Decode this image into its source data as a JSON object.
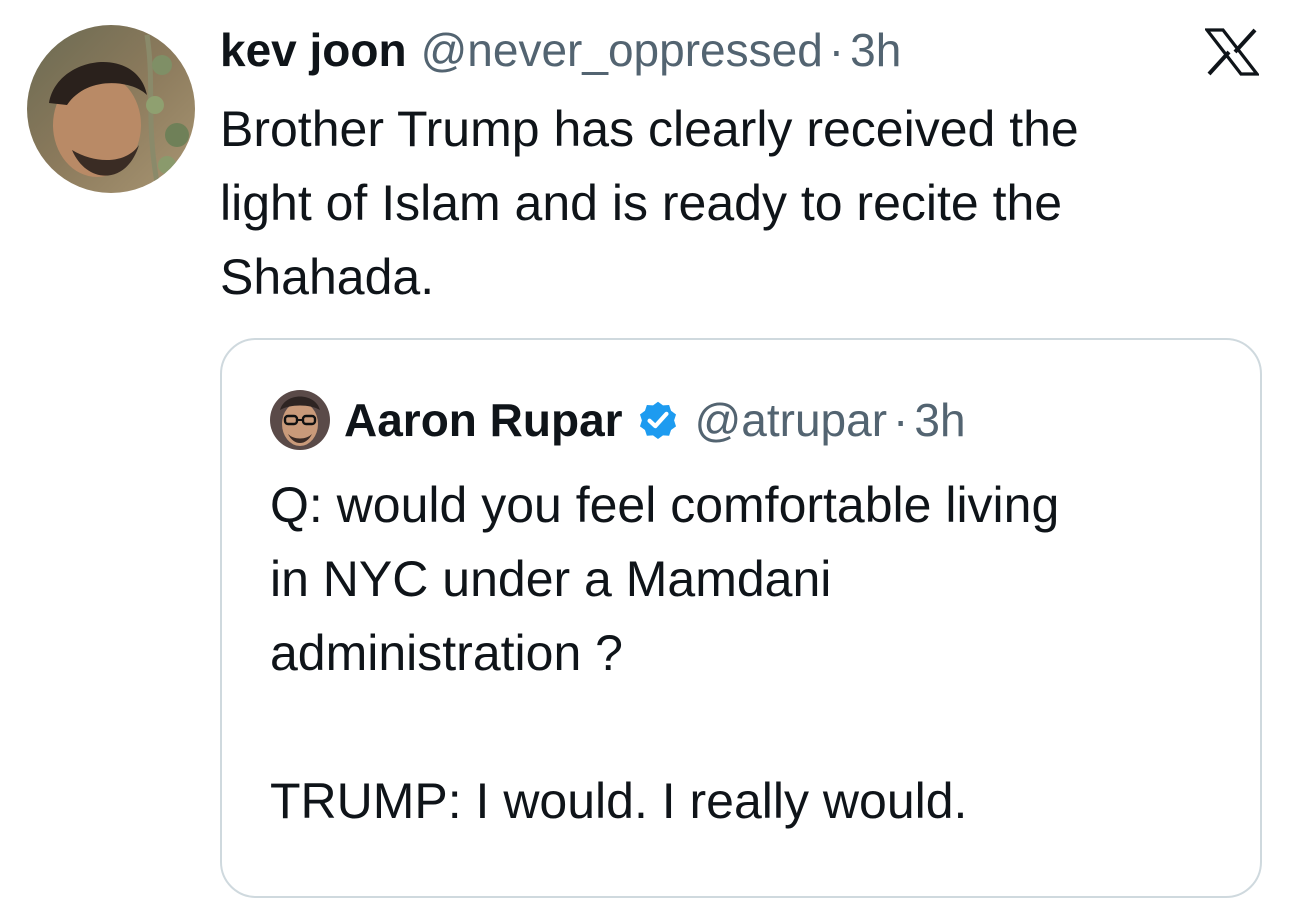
{
  "post": {
    "author_name": "kev joon",
    "handle": "@never_oppressed",
    "separator": "·",
    "time": "3h",
    "text": "Brother Trump has clearly received the\nlight of Islam and is ready to recite the\nShahada.",
    "platform_icon": "x-logo-icon",
    "avatar_icon": "profile-photo"
  },
  "quoted_post": {
    "author_name": "Aaron Rupar",
    "verified": true,
    "verified_icon": "verified-badge-icon",
    "handle": "@atrupar",
    "separator": "·",
    "time": "3h",
    "text": "Q: would you feel comfortable living\nin NYC under a Mamdani\nadministration ?\n\nTRUMP: I would. I really would.",
    "avatar_icon": "profile-photo"
  },
  "colors": {
    "text_primary": "#0f1419",
    "text_secondary": "#536471",
    "border": "#cfd9de",
    "verified_blue": "#1d9bf0",
    "background": "#ffffff"
  }
}
